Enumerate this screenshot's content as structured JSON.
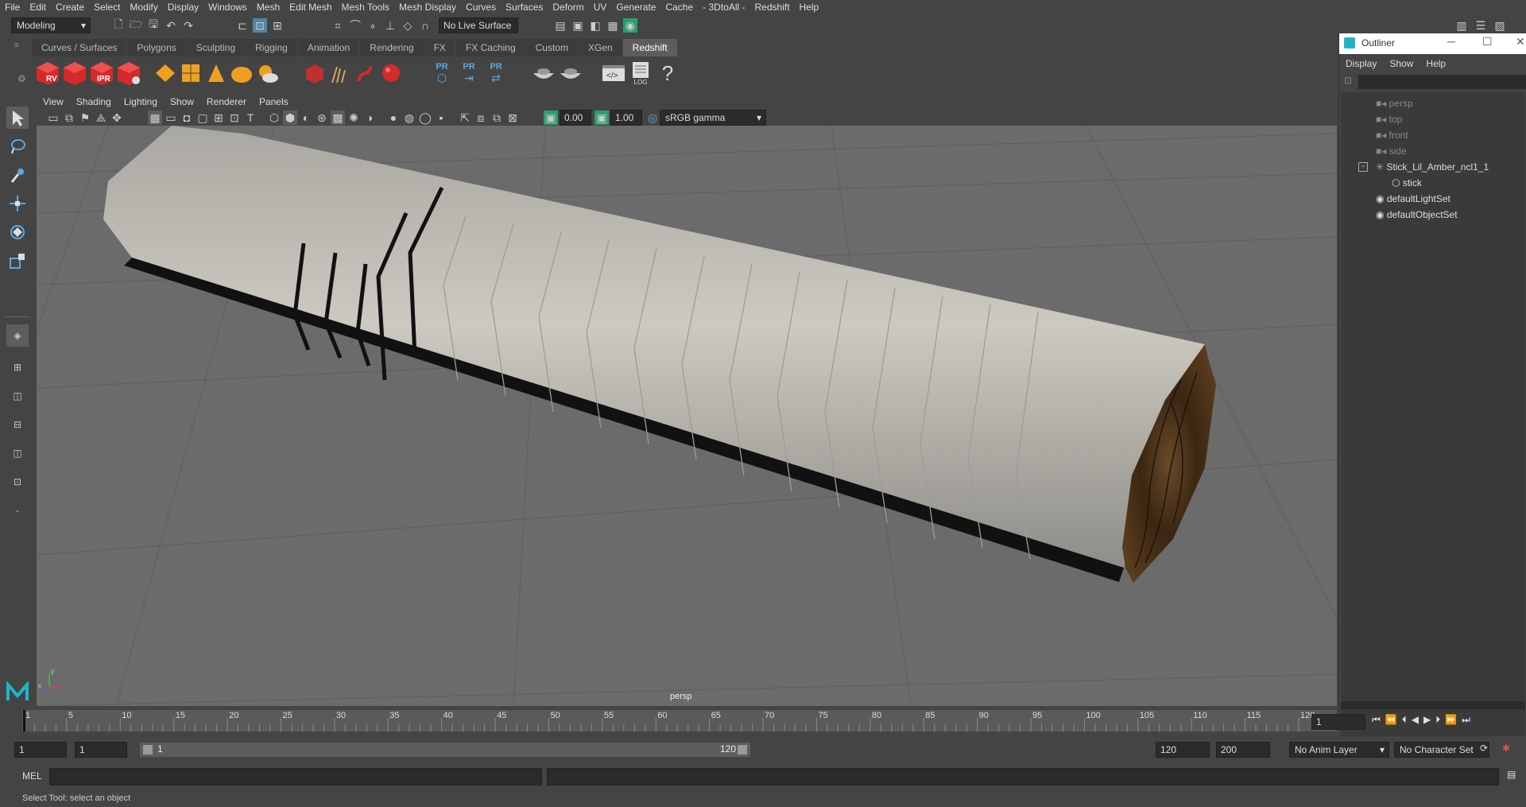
{
  "menubar": {
    "items": [
      "File",
      "Edit",
      "Create",
      "Select",
      "Modify",
      "Display",
      "Windows",
      "Mesh",
      "Edit Mesh",
      "Mesh Tools",
      "Mesh Display",
      "Curves",
      "Surfaces",
      "Deform",
      "UV",
      "Generate",
      "Cache",
      "- 3DtoAll -",
      "Redshift",
      "Help"
    ]
  },
  "statusline": {
    "mode": "Modeling",
    "live_surface": "No Live Surface"
  },
  "shelf": {
    "tabs": [
      "Curves / Surfaces",
      "Polygons",
      "Sculpting",
      "Rigging",
      "Animation",
      "Rendering",
      "FX",
      "FX Caching",
      "Custom",
      "XGen",
      "Redshift"
    ],
    "active_tab": "Redshift",
    "rs_labels": [
      "RV",
      "IPR"
    ],
    "pr_labels": [
      "PR",
      "PR",
      "PR"
    ],
    "log_label": "LOG",
    "help_glyph": "?"
  },
  "viewport": {
    "menu": [
      "View",
      "Shading",
      "Lighting",
      "Show",
      "Renderer",
      "Panels"
    ],
    "exposure": "0.00",
    "gamma": "1.00",
    "color_space": "sRGB gamma",
    "camera_label": "persp",
    "axis_x": "x",
    "axis_y": "y"
  },
  "outliner": {
    "title": "Outliner",
    "menu": [
      "Display",
      "Show",
      "Help"
    ],
    "items": [
      {
        "label": "persp",
        "dim": true
      },
      {
        "label": "top",
        "dim": true
      },
      {
        "label": "front",
        "dim": true
      },
      {
        "label": "side",
        "dim": true
      },
      {
        "label": "Stick_Lil_Amber_ncl1_1",
        "dim": false
      },
      {
        "label": "stick",
        "dim": false
      },
      {
        "label": "defaultLightSet",
        "dim": false
      },
      {
        "label": "defaultObjectSet",
        "dim": false
      }
    ]
  },
  "timeline": {
    "ticks": [
      "1",
      "5",
      "10",
      "15",
      "20",
      "25",
      "30",
      "35",
      "40",
      "45",
      "50",
      "55",
      "60",
      "65",
      "70",
      "75",
      "80",
      "85",
      "90",
      "95",
      "100",
      "105",
      "110",
      "115",
      "120"
    ],
    "current_frame": "1"
  },
  "range": {
    "start": "1",
    "playback_start": "1",
    "slider_start": "1",
    "slider_end": "120",
    "playback_end": "120",
    "end": "200",
    "anim_layer": "No Anim Layer",
    "character_set": "No Character Set"
  },
  "cmdline": {
    "label": "MEL"
  },
  "helpline": {
    "text": "Select Tool: select an object"
  },
  "colors": {
    "accent": "#5d5d5d",
    "redshift_red": "#d42a2a",
    "selected_tool": "#5285a6"
  }
}
